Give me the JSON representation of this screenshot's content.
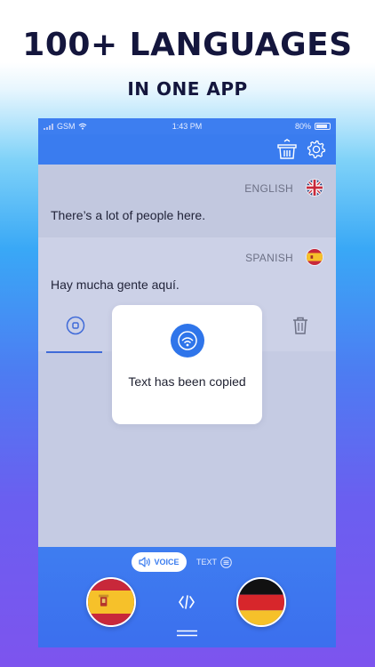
{
  "promo": {
    "headline": "100+ LANGUAGES",
    "subhead": "IN ONE APP"
  },
  "status_bar": {
    "carrier": "GSM",
    "time": "1:43 PM",
    "battery": "80%"
  },
  "nav": {
    "icons": [
      "basket-icon",
      "gear-icon"
    ]
  },
  "translations": [
    {
      "language": "ENGLISH",
      "flag": "uk-flag-icon",
      "text": "There’s a lot of people here."
    },
    {
      "language": "SPANISH",
      "flag": "spain-flag-icon",
      "text": "Hay mucha gente aquí."
    }
  ],
  "toast": {
    "message": "Text has been copied",
    "icon": "copy-success-icon"
  },
  "modes": {
    "voice_label": "VOICE",
    "text_label": "TEXT",
    "active": "VOICE"
  },
  "languages": {
    "source_flag": "spain-flag-icon",
    "target_flag": "germany-flag-icon"
  },
  "colors": {
    "accent": "#3a7cef",
    "headline": "#14163d",
    "toast_icon": "#2f75ea"
  }
}
